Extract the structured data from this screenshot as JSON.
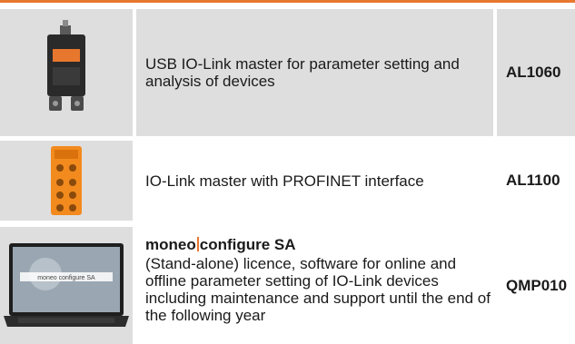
{
  "products": [
    {
      "description": "USB IO-Link master for parameter setting and analysis of devices",
      "code": "AL1060",
      "image": "usb-io-link-master-device"
    },
    {
      "description": "IO-Link master with PROFINET interface",
      "code": "AL1100",
      "image": "orange-io-link-module"
    },
    {
      "title_part1": "moneo",
      "title_part2": "configure SA",
      "description": "(Stand-alone) licence, software for online and offline parameter setting of IO-Link devices including maintenance and support until the end of the following year",
      "code": "QMP010",
      "image": "laptop-with-software",
      "screen_text": "moneo configure SA"
    }
  ],
  "colors": {
    "accent": "#e8772e",
    "cell_bg": "#dedede"
  }
}
